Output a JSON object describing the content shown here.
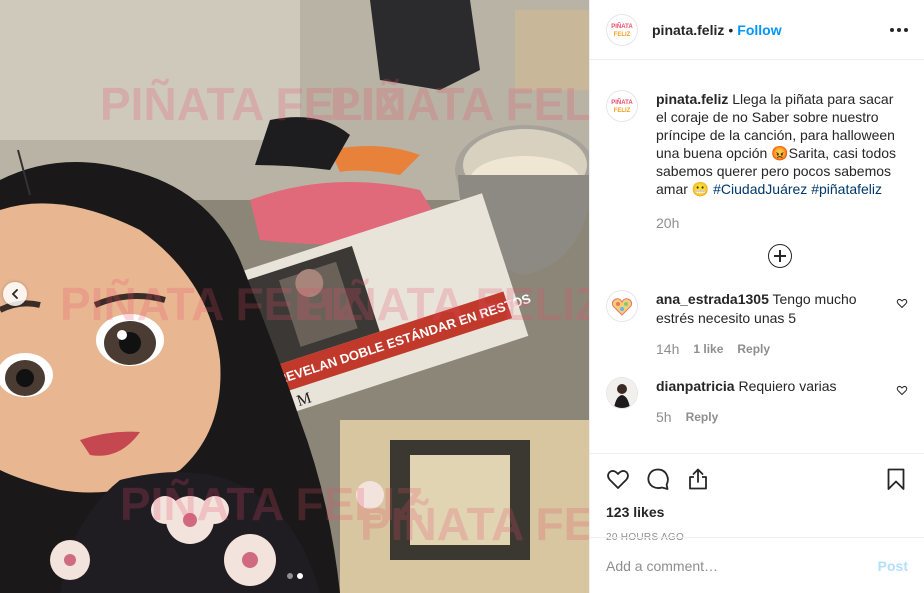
{
  "photo": {
    "watermark_text": "PIÑATA FELIZ",
    "newspaper_headline": "REVELAN DOBLE ESTÁNDAR EN RESTOS",
    "newspaper_letter": "M",
    "carousel_total": 2,
    "carousel_active": 2
  },
  "header": {
    "username": "pinata.feliz",
    "separator": "•",
    "follow_label": "Follow",
    "avatar_text": "PIÑATA FELIZ"
  },
  "caption": {
    "username": "pinata.feliz",
    "text_part1": " Llega la piñata para sacar el coraje de no Saber sobre nuestro príncipe de la canción, para halloween una buena opción ",
    "emoji_angry": "😡",
    "text_part2": "Sarita, casi todos sabemos querer pero pocos sabemos amar ",
    "emoji_grin": "😬",
    "hashtag1": "#CiudadJuárez",
    "hashtag2": "#piñatafeliz",
    "time": "20h"
  },
  "comments": [
    {
      "username": "ana_estrada1305",
      "text": "Tengo mucho estrés necesito unas 5",
      "time": "14h",
      "likes": "1 like",
      "reply": "Reply"
    },
    {
      "username": "dianpatricia",
      "text": "Requiero varias",
      "time": "5h",
      "reply": "Reply"
    }
  ],
  "actions": {
    "likes_count": "123 likes",
    "posted_ago": "20 HOURS AGO"
  },
  "add_comment": {
    "placeholder": "Add a comment…",
    "post_label": "Post"
  },
  "colors": {
    "accent_blue": "#0095f6",
    "post_disabled": "#b2dffc",
    "hashtag": "#00376b",
    "muted": "#8e8e8e"
  }
}
